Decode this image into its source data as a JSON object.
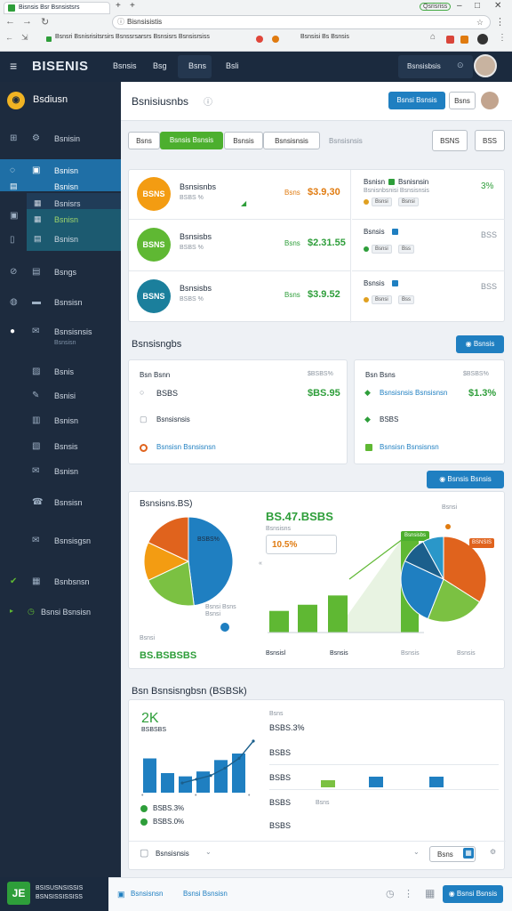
{
  "browser": {
    "tab_title": "Bisnsis Bsr Bsnsistsrs",
    "new_tab": "+",
    "window_controls": [
      "Qsrisriss",
      "–",
      "□",
      "✕"
    ],
    "url": "Bisnsisistis",
    "bookmarks": [
      "Bsnsri Bsnisrisitsrsirs Bsnssrsarsrs Bsnsisrs Bsnsisrsiss",
      "Bsnsisi Bs Bsnsis"
    ]
  },
  "topbar": {
    "brand": "BISENIS",
    "nav": [
      "Bsnsis",
      "Bsg",
      "Bsns",
      "Bsli"
    ],
    "user_name": "Bsnsisbsis"
  },
  "sidebar": {
    "title": "Bsdiusn",
    "items": [
      {
        "label": "Bsnisin"
      },
      {
        "label": "Bsnisn"
      },
      {
        "label": "Bsnisn"
      },
      {
        "label": "Bsnisrs"
      },
      {
        "label": "Bsnisn"
      },
      {
        "label": "Bsnisn"
      },
      {
        "label": "Bsngs"
      },
      {
        "label": "Bsnsisn"
      },
      {
        "label": "Bsnsisnsis"
      },
      {
        "label": "Bsnsisn"
      },
      {
        "label": "Bsnis"
      },
      {
        "label": "Bsnisi"
      },
      {
        "label": "Bsnisn"
      },
      {
        "label": "Bsnsis"
      },
      {
        "label": "Bsnisn"
      },
      {
        "label": "Bsnsisn"
      },
      {
        "label": "Bsnsisgsn"
      },
      {
        "label": "Bsnbsnsn"
      },
      {
        "label": "Bsnsi Bsnsisn"
      }
    ],
    "footer_text_1": "BSISUSNSISSIS",
    "footer_text_2": "BSNSISSISSISS"
  },
  "header": {
    "title": "Bsnisiusnbs",
    "primary_button": "Bsnsi Bsnsis",
    "secondary_button": "Bsns"
  },
  "filters": {
    "tabs": [
      "Bsns",
      "Bsnsis Bsnsis",
      "Bsnsis",
      "Bsnsisnsis"
    ],
    "extra": "Bsnsisnsis",
    "right_buttons": [
      "BSNS",
      "BSS"
    ]
  },
  "accounts": [
    {
      "name": "Bsnsisnbs",
      "sub": "BSBS %",
      "tag": "Bsns",
      "amount": "$3.9,30",
      "color": "#f39c12",
      "icon": "BSNS",
      "side_title": "Bsnisn",
      "side_tag": "Bsnisnsin",
      "side_sub": "Bsnisnbsnisi Bsnsisnsis",
      "side_pct": "3%",
      "chips": [
        "Bsnsi",
        "Bsnsi"
      ]
    },
    {
      "name": "Bsnsisbs",
      "sub": "BSBS %",
      "tag": "Bsns",
      "amount": "$2.31.55",
      "color": "#5fb833",
      "icon": "BSNS",
      "side_title": "Bsnsis",
      "side_tag": "",
      "side_sub": "",
      "side_pct": "BSS",
      "chips": [
        "Bsnsi",
        "Bss"
      ]
    },
    {
      "name": "Bsnsisbs",
      "sub": "BSBS %",
      "tag": "Bsns",
      "amount": "$3.9.52",
      "color": "#1b7f9c",
      "icon": "BSNS",
      "side_title": "Bsnsis",
      "side_tag": "",
      "side_sub": "",
      "side_pct": "BSS",
      "chips": [
        "Bsnsi",
        "Bss"
      ]
    }
  ],
  "transactions": {
    "title": "Bsnsisngbs",
    "button": "Bsnsis",
    "left": {
      "head": "Bsn Bsnn",
      "head_value": "$BSBS%",
      "rows": [
        {
          "label": "BSBS",
          "value": "$BS.95"
        },
        {
          "label": "Bsnsisnsis",
          "value": ""
        },
        {
          "label": "Bsnsisn Bsnsisnsn",
          "value": ""
        }
      ]
    },
    "right": {
      "head": "Bsn Bsns",
      "head_value": "$BSBS%",
      "rows": [
        {
          "label": "Bsnsisnsis Bsnsisnsn",
          "value": "$1.3%"
        },
        {
          "label": "BSBS",
          "value": ""
        },
        {
          "label": "Bsnsisn Bsnsisnsn",
          "value": ""
        }
      ]
    },
    "footer_button": "Bsnsis Bsnsis"
  },
  "overview": {
    "title": "Bsnsisns.BS)",
    "pie_label": "BSBS%",
    "pie_caption": "Bsnsi Bsns Bsnsi",
    "left_footer_1": "Bsnsi",
    "left_footer_value": "BS.BSBSBS",
    "kpi_value": "BS.47.BSBS",
    "kpi_sub": "Bsnsisns",
    "kpi_pct": "10.5%",
    "tooltip": "Bsnsisbs",
    "right_footer": [
      "Bsnsisl",
      "Bsnsis",
      "Bsnsis",
      "Bsnsis"
    ],
    "legend_caption": "Bsnsi",
    "legend_badge": "BSNSIS",
    "bar_values": [
      35,
      45,
      60,
      100
    ],
    "pie_slices": [
      {
        "value": 48,
        "color": "#1f7fc1"
      },
      {
        "value": 20,
        "color": "#7bc142"
      },
      {
        "value": 14,
        "color": "#f39c12"
      },
      {
        "value": 18,
        "color": "#e0631d"
      }
    ],
    "donut_slices": [
      {
        "value": 34,
        "color": "#e0631d"
      },
      {
        "value": 22,
        "color": "#7bc142"
      },
      {
        "value": 26,
        "color": "#1f7fc1"
      },
      {
        "value": 10,
        "color": "#1b5f8c"
      },
      {
        "value": 8,
        "color": "#2a97c9"
      }
    ]
  },
  "performance": {
    "title": "Bsn Bsnsisngbsn (BSBSk)",
    "big": "2K",
    "big_sub": "BSBSBS",
    "legend": [
      {
        "label": "BSBS.3%",
        "color": "#2e9e3a"
      },
      {
        "label": "BSBS.0%",
        "color": "#2e9e3a"
      }
    ],
    "bar_values": [
      42,
      24,
      20,
      26,
      40,
      48
    ],
    "line_values": [
      10,
      16,
      22,
      34,
      50,
      78
    ],
    "table_head": "Bsns",
    "table_values": [
      "BSBS.3%",
      "BSBS",
      "BSBS",
      "BSBS",
      "BSBS"
    ],
    "table_sub": "Bsns",
    "small_bars": [
      8,
      12,
      12
    ],
    "footer_select": "Bsnsisnsis",
    "footer_button": "Bsns"
  },
  "bottom": {
    "links": [
      "Bsnsisnsn",
      "Bsnsi Bsnsisn"
    ],
    "button": "Bsnsi Bsnsis"
  }
}
